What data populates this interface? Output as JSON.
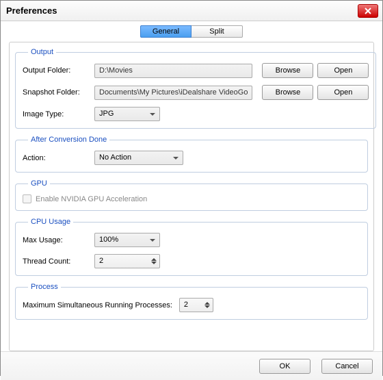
{
  "window": {
    "title": "Preferences"
  },
  "tabs": {
    "general": "General",
    "split": "Split"
  },
  "groups": {
    "output": {
      "legend": "Output",
      "output_folder_label": "Output Folder:",
      "output_folder_value": "D:\\Movies",
      "snapshot_folder_label": "Snapshot Folder:",
      "snapshot_folder_value": "Documents\\My Pictures\\iDealshare VideoGo",
      "image_type_label": "Image Type:",
      "image_type_value": "JPG",
      "browse": "Browse",
      "open": "Open"
    },
    "after": {
      "legend": "After Conversion Done",
      "action_label": "Action:",
      "action_value": "No Action"
    },
    "gpu": {
      "legend": "GPU",
      "enable_label": "Enable NVIDIA GPU Acceleration"
    },
    "cpu": {
      "legend": "CPU Usage",
      "max_usage_label": "Max Usage:",
      "max_usage_value": "100%",
      "thread_count_label": "Thread Count:",
      "thread_count_value": "2"
    },
    "process": {
      "legend": "Process",
      "max_proc_label": "Maximum Simultaneous Running Processes:",
      "max_proc_value": "2"
    }
  },
  "footer": {
    "ok": "OK",
    "cancel": "Cancel"
  }
}
